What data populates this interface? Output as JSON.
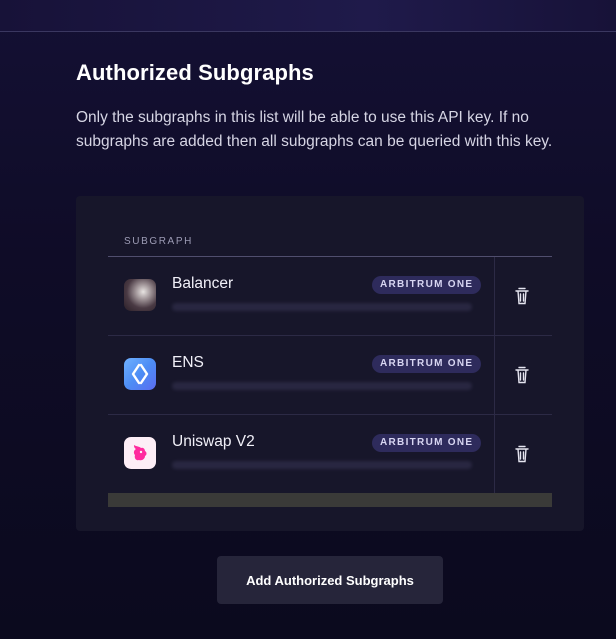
{
  "section": {
    "title": "Authorized Subgraphs",
    "description": "Only the subgraphs in this list will be able to use this API key. If no subgraphs are added then all subgraphs can be queried with this key."
  },
  "table": {
    "column_header": "SUBGRAPH",
    "rows": [
      {
        "name": "Balancer",
        "network": "ARBITRUM ONE",
        "icon": "balancer-logo"
      },
      {
        "name": "ENS",
        "network": "ARBITRUM ONE",
        "icon": "ens-logo"
      },
      {
        "name": "Uniswap V2",
        "network": "ARBITRUM ONE",
        "icon": "uniswap-logo"
      }
    ]
  },
  "actions": {
    "add_label": "Add Authorized Subgraphs"
  },
  "colors": {
    "background": "#0f0c27",
    "card": "#17162a",
    "badge": "#2e2b5c",
    "button": "#26253a"
  }
}
